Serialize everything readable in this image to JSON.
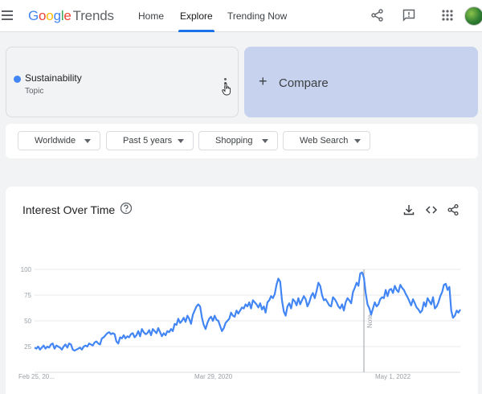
{
  "header": {
    "logo_letters": [
      "G",
      "o",
      "o",
      "g",
      "l",
      "e"
    ],
    "logo_trends": "Trends",
    "nav": [
      "Home",
      "Explore",
      "Trending Now"
    ],
    "active_nav": "Explore",
    "icons": [
      "menu-icon",
      "share-icon",
      "feedback-icon",
      "apps-icon",
      "avatar"
    ]
  },
  "term": {
    "title": "Sustainability",
    "subtitle": "Topic",
    "color": "#4285f4"
  },
  "compare": {
    "plus": "+",
    "label": "Compare"
  },
  "filters": [
    "Worldwide",
    "Past 5 years",
    "Shopping",
    "Web Search"
  ],
  "chart_card": {
    "title": "Interest Over Time",
    "icons": [
      "help-icon",
      "download-icon",
      "embed-icon",
      "share-icon"
    ]
  },
  "chart_data": {
    "type": "line",
    "title": "Interest Over Time",
    "xlabel": "",
    "ylabel": "",
    "ylim": [
      0,
      100
    ],
    "yticks": [
      25,
      50,
      75,
      100
    ],
    "xticks": [
      "Feb 25, 20...",
      "Mar 29, 2020",
      "May 1, 2022"
    ],
    "annotation": "Note",
    "grid": true,
    "series": [
      {
        "color": "#4285f4",
        "values": [
          24,
          23,
          25,
          22,
          24,
          26,
          23,
          25,
          24,
          27,
          28,
          23,
          26,
          25,
          24,
          22,
          25,
          27,
          24,
          28,
          27,
          22,
          21,
          22,
          23,
          24,
          22,
          25,
          26,
          25,
          28,
          27,
          26,
          29,
          30,
          28,
          27,
          33,
          34,
          36,
          38,
          39,
          37,
          38,
          37,
          30,
          28,
          34,
          33,
          36,
          33,
          35,
          34,
          37,
          38,
          34,
          36,
          40,
          35,
          42,
          39,
          37,
          38,
          41,
          36,
          42,
          40,
          38,
          43,
          39,
          35,
          38,
          36,
          40,
          39,
          42,
          40,
          47,
          46,
          52,
          48,
          50,
          53,
          49,
          55,
          52,
          47,
          56,
          60,
          64,
          66,
          64,
          53,
          46,
          42,
          48,
          52,
          54,
          50,
          55,
          51,
          50,
          45,
          40,
          43,
          48,
          50,
          52,
          58,
          55,
          54,
          60,
          57,
          60,
          63,
          62,
          66,
          64,
          68,
          62,
          70,
          68,
          66,
          63,
          67,
          61,
          64,
          58,
          68,
          70,
          74,
          72,
          76,
          85,
          91,
          88,
          70,
          59,
          55,
          64,
          67,
          62,
          71,
          69,
          65,
          72,
          66,
          70,
          74,
          71,
          64,
          68,
          74,
          77,
          72,
          79,
          87,
          84,
          75,
          70,
          71,
          68,
          65,
          64,
          73,
          71,
          68,
          64,
          62,
          66,
          60,
          68,
          72,
          70,
          67,
          78,
          82,
          87,
          84,
          96,
          97,
          92,
          77,
          66,
          62,
          56,
          62,
          68,
          64,
          66,
          71,
          73,
          72,
          80,
          74,
          80,
          81,
          77,
          84,
          80,
          78,
          85,
          82,
          80,
          76,
          73,
          69,
          65,
          71,
          67,
          63,
          61,
          58,
          60,
          68,
          64,
          72,
          69,
          66,
          73,
          62,
          64,
          68,
          74,
          78,
          85,
          86,
          80,
          83,
          60,
          53,
          55,
          60,
          58,
          61
        ]
      }
    ]
  }
}
